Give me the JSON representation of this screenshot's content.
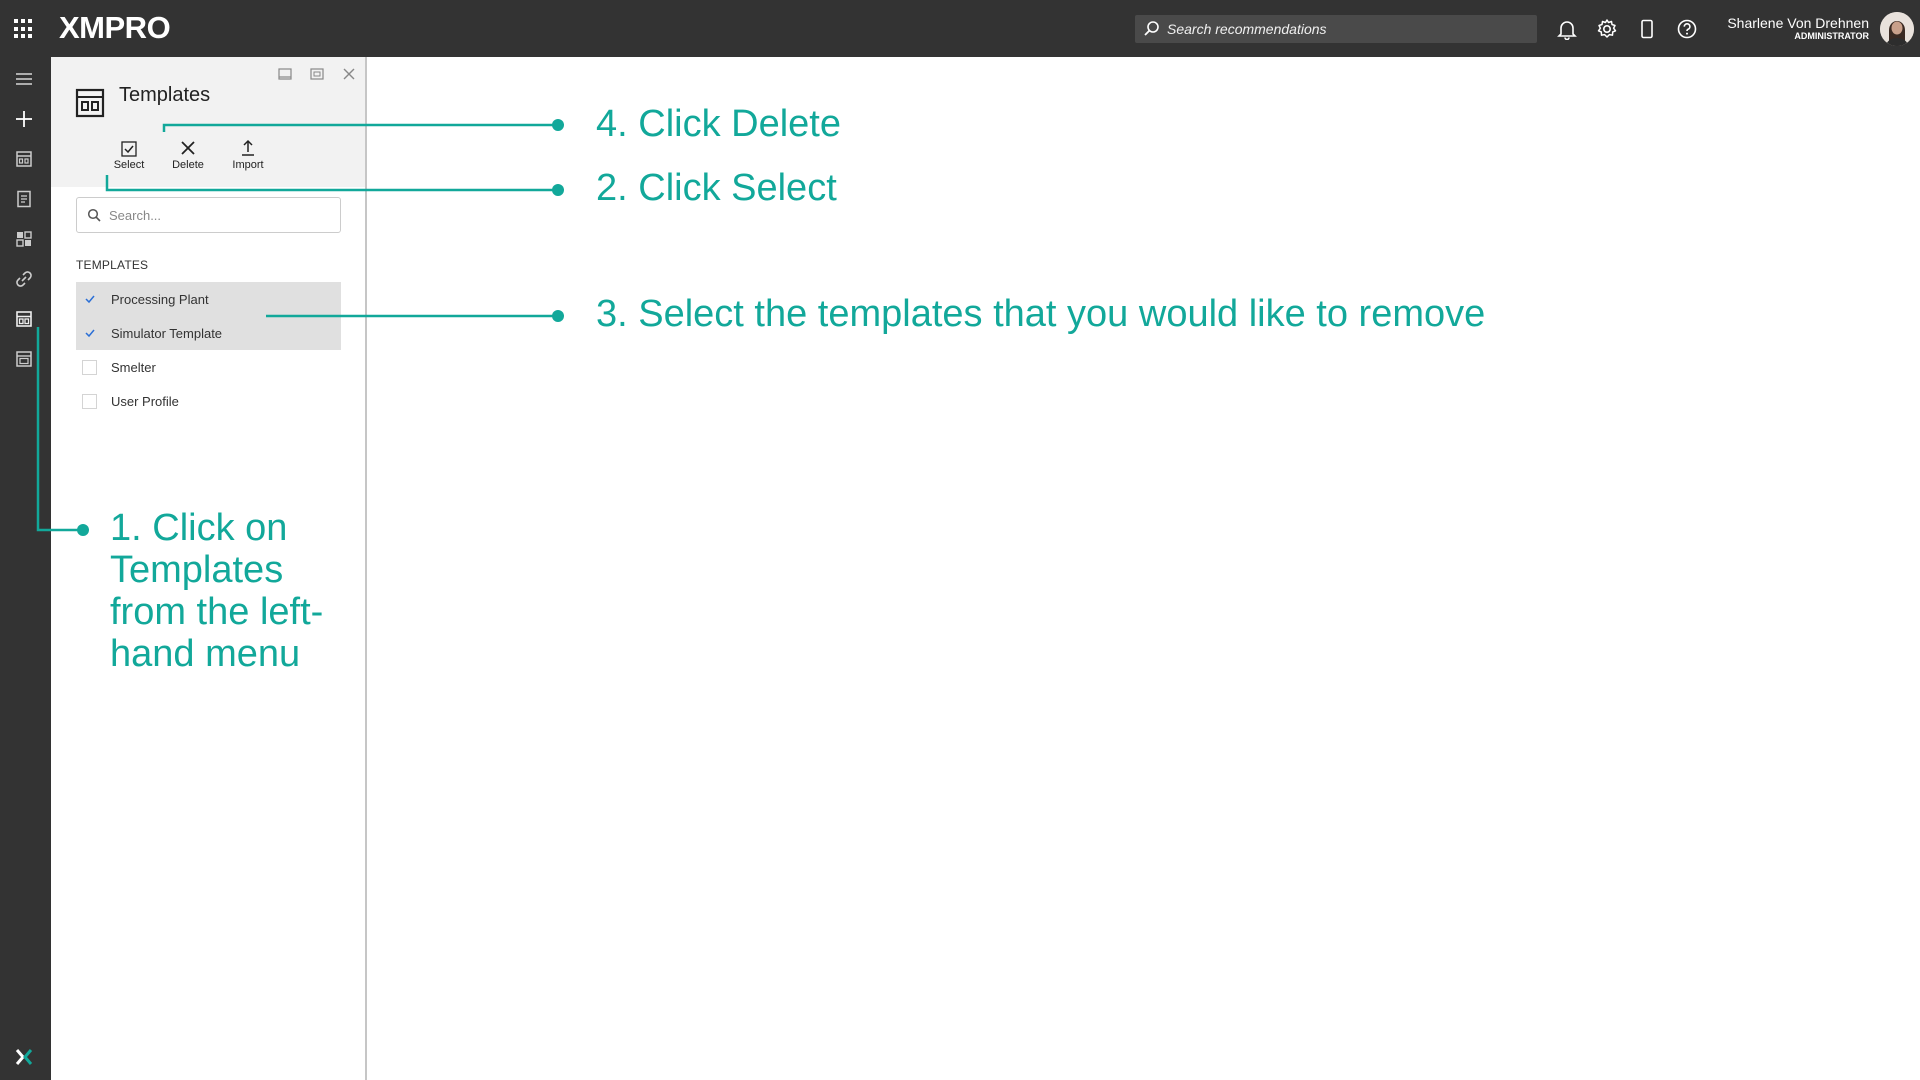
{
  "topbar": {
    "logo": "XMPRO",
    "search_placeholder": "Search recommendations",
    "user": {
      "name": "Sharlene Von Drehnen",
      "role": "ADMINISTRATOR"
    }
  },
  "panel": {
    "title": "Templates",
    "toolbar": {
      "select_label": "Select",
      "delete_label": "Delete",
      "import_label": "Import"
    },
    "search_placeholder": "Search...",
    "section_label": "TEMPLATES",
    "items": [
      {
        "label": "Processing Plant",
        "checked": true
      },
      {
        "label": "Simulator Template",
        "checked": true
      },
      {
        "label": "Smelter",
        "checked": false
      },
      {
        "label": "User Profile",
        "checked": false
      }
    ]
  },
  "annotations": {
    "step1": "1. Click on Templates from the left-hand menu",
    "step2": "2. Click Select",
    "step3": "3. Select the templates that you would like to remove",
    "step4": "4. Click Delete"
  },
  "colors": {
    "accent": "#12a89a",
    "topbar": "#333333",
    "rail": "#333333",
    "panel_header": "#f2f2f2"
  }
}
